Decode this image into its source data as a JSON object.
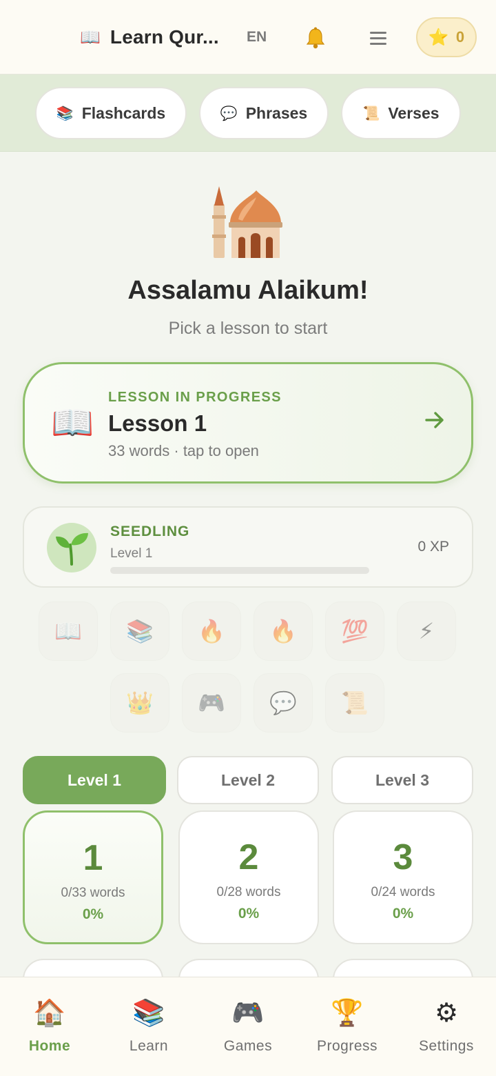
{
  "header": {
    "title": "Learn Qur...",
    "language": "EN",
    "stars_count": "0",
    "book_icon": "📖",
    "star_icon": "⭐"
  },
  "modes": [
    {
      "label": "Flashcards",
      "icon": "📚"
    },
    {
      "label": "Phrases",
      "icon": "💬"
    },
    {
      "label": "Verses",
      "icon": "📜"
    }
  ],
  "welcome": {
    "title": "Assalamu Alaikum!",
    "subtitle": "Pick a lesson to start"
  },
  "current_lesson": {
    "eyebrow": "LESSON IN PROGRESS",
    "title": "Lesson 1",
    "subtitle": "33 words · tap to open",
    "book_icon": "📖"
  },
  "xp": {
    "rank": "SEEDLING",
    "level": "Level 1",
    "xp_text": "0 XP",
    "progress": 0
  },
  "badges": [
    {
      "icon": "📖",
      "name": "book"
    },
    {
      "icon": "📚",
      "name": "books"
    },
    {
      "icon": "🔥",
      "name": "fire"
    },
    {
      "icon": "🔥",
      "name": "fire"
    },
    {
      "icon": "💯",
      "name": "hundred"
    },
    {
      "icon": "⚡",
      "name": "lightning"
    },
    {
      "icon": "👑",
      "name": "crown"
    },
    {
      "icon": "🎮",
      "name": "gamepad"
    },
    {
      "icon": "💬",
      "name": "speech"
    },
    {
      "icon": "📜",
      "name": "scroll"
    }
  ],
  "levels": [
    {
      "label": "Level 1",
      "active": true
    },
    {
      "label": "Level 2",
      "active": false
    },
    {
      "label": "Level 3",
      "active": false
    }
  ],
  "lessons": [
    {
      "number": "1",
      "words": "0/33 words",
      "percent": "0%",
      "active": true
    },
    {
      "number": "2",
      "words": "0/28 words",
      "percent": "0%",
      "active": false
    },
    {
      "number": "3",
      "words": "0/24 words",
      "percent": "0%",
      "active": false
    }
  ],
  "nav": [
    {
      "label": "Home",
      "icon": "🏠",
      "active": true
    },
    {
      "label": "Learn",
      "icon": "📚",
      "active": false
    },
    {
      "label": "Games",
      "icon": "🎮",
      "active": false
    },
    {
      "label": "Progress",
      "icon": "🏆",
      "active": false
    },
    {
      "label": "Settings",
      "icon": "⚙",
      "active": false
    }
  ],
  "colors": {
    "accent": "#78a95a",
    "accent_text": "#6a9f4a",
    "header_bg": "#fdfbf4",
    "strip_bg": "#e1ebd7"
  }
}
